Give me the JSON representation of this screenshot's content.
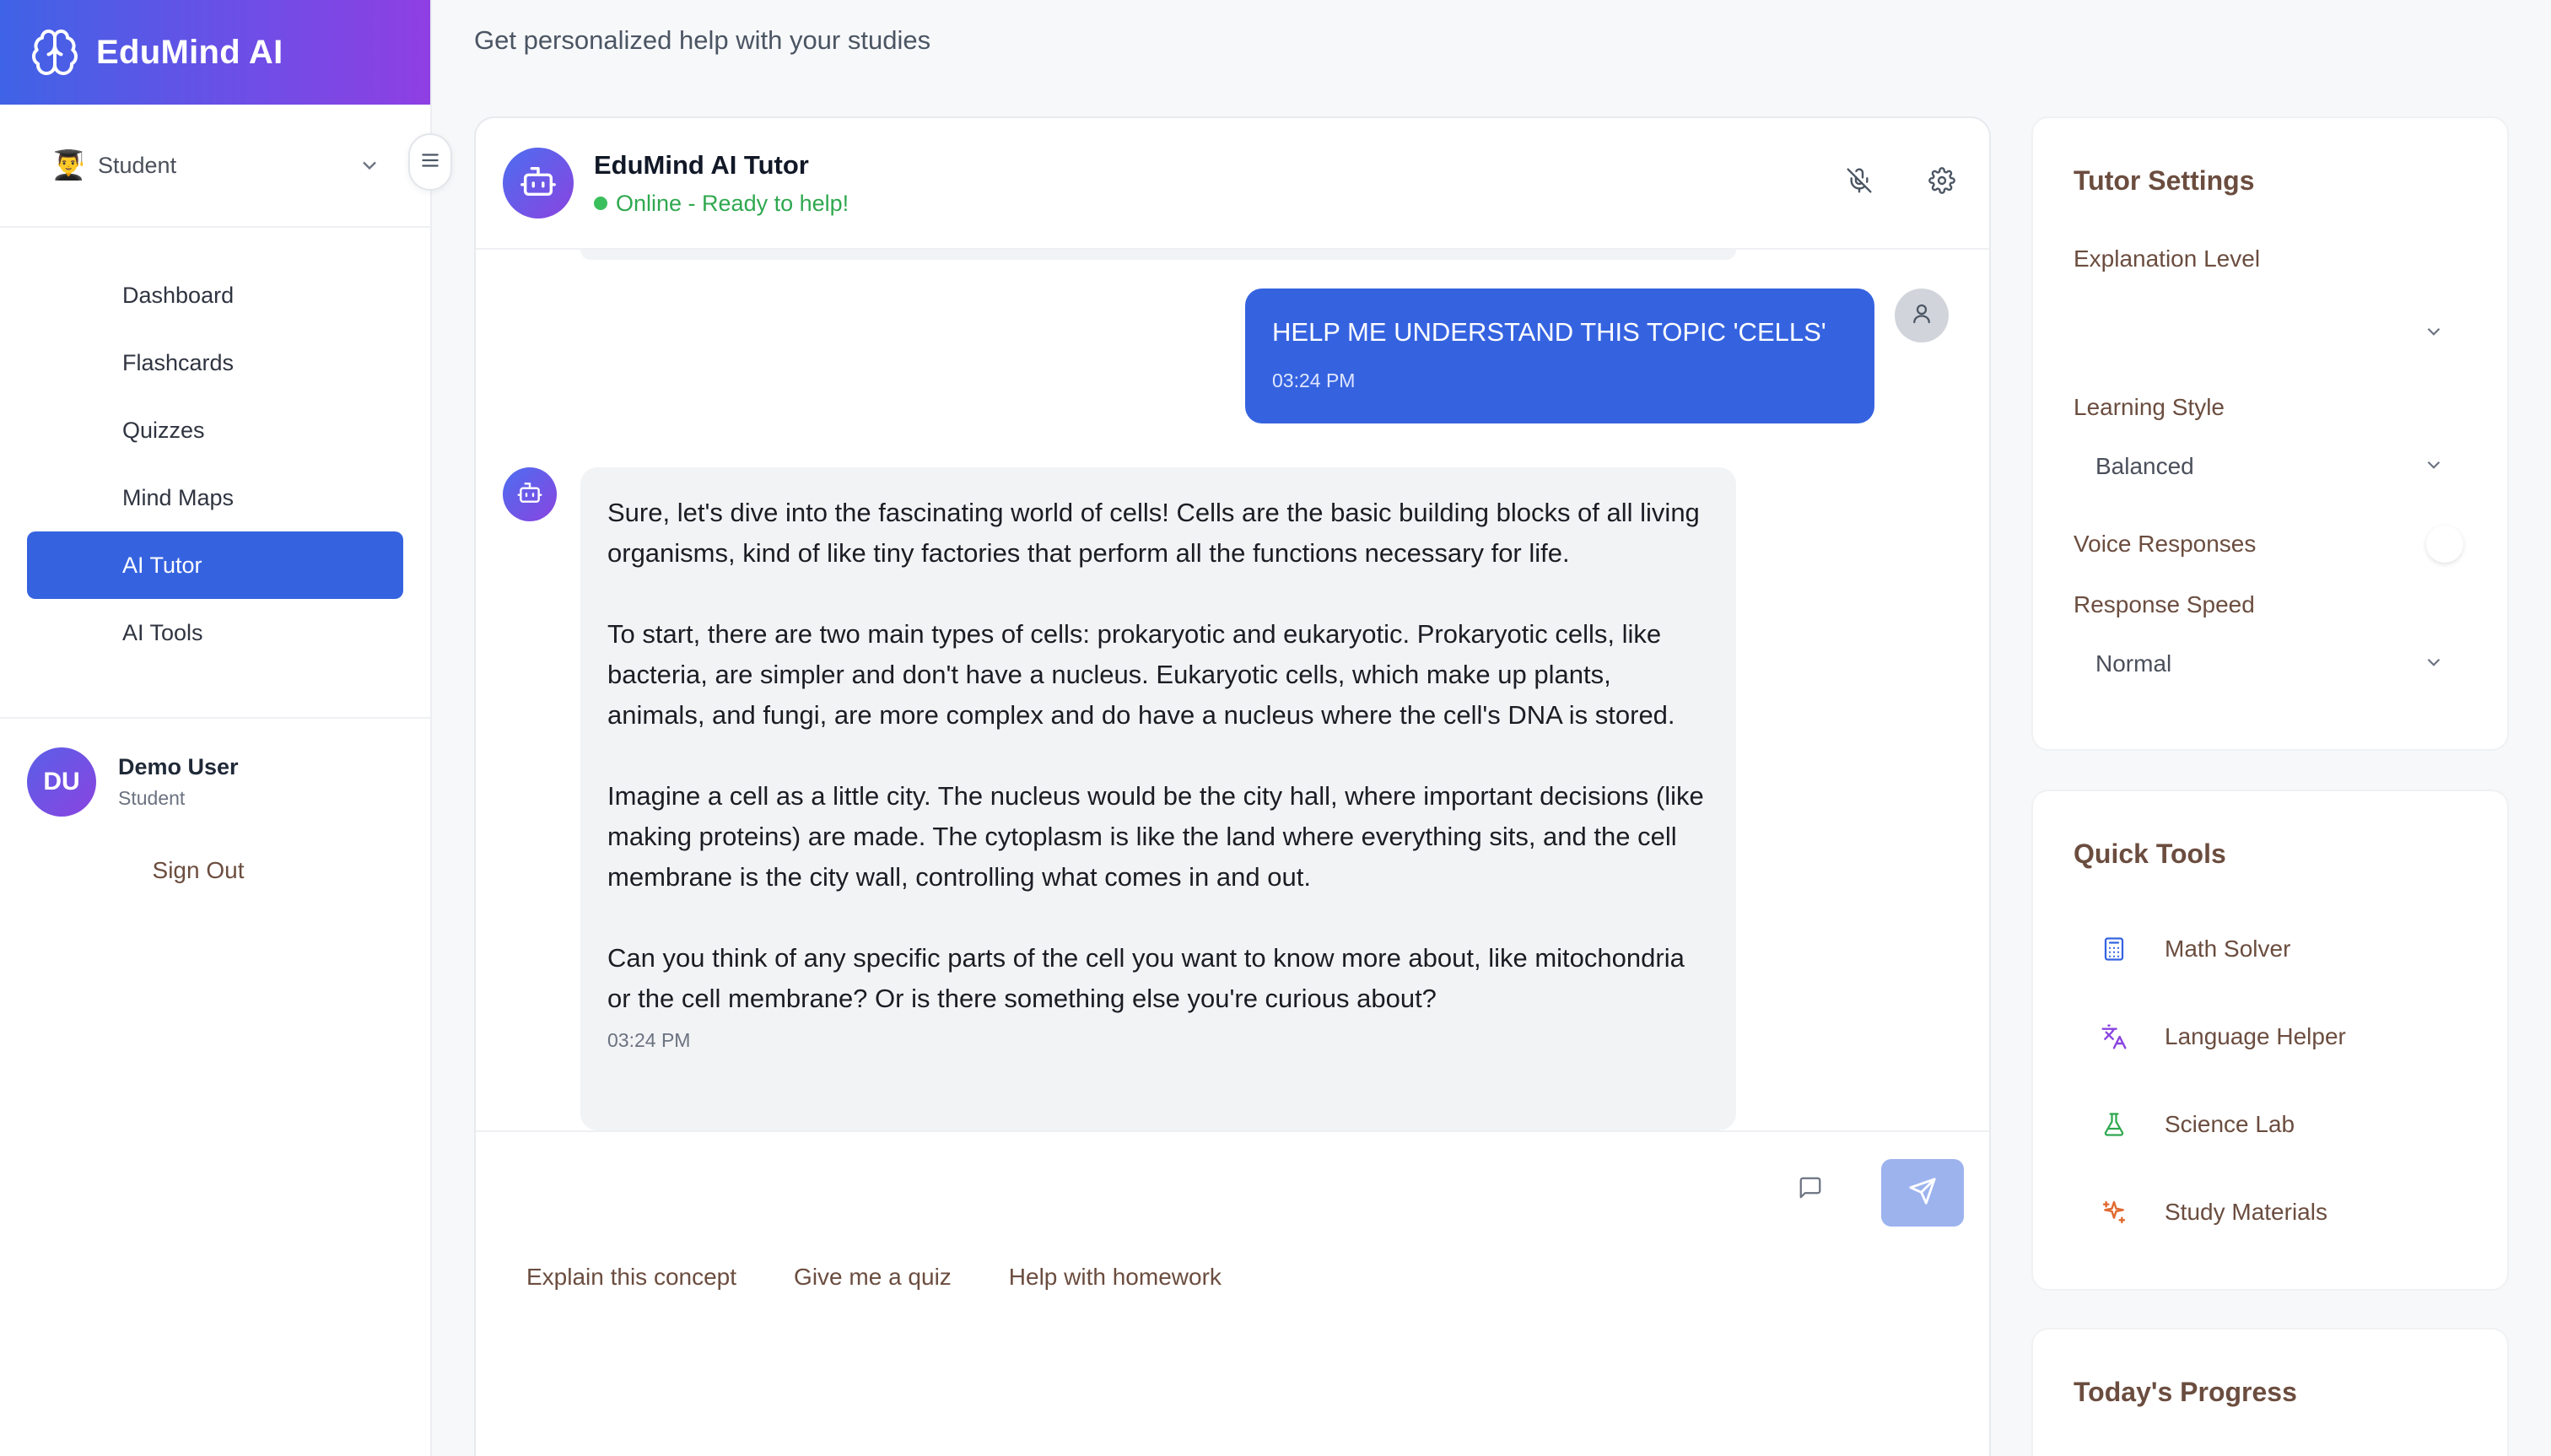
{
  "app": {
    "name": "EduMind AI",
    "subtitle": "Get personalized help with your studies"
  },
  "sidebar": {
    "role": {
      "emoji": "👨‍🎓",
      "label": "Student"
    },
    "items": [
      {
        "label": "Dashboard",
        "active": false
      },
      {
        "label": "Flashcards",
        "active": false
      },
      {
        "label": "Quizzes",
        "active": false
      },
      {
        "label": "Mind Maps",
        "active": false
      },
      {
        "label": "AI Tutor",
        "active": true
      },
      {
        "label": "AI Tools",
        "active": false
      }
    ],
    "user": {
      "initials": "DU",
      "name": "Demo User",
      "role": "Student"
    },
    "sign_out": "Sign Out"
  },
  "chat": {
    "title": "EduMind AI Tutor",
    "status": "Online - Ready to help!",
    "messages": [
      {
        "from": "user",
        "text": "HELP ME UNDERSTAND THIS TOPIC 'CELLS'",
        "time": "03:24 PM"
      },
      {
        "from": "bot",
        "paragraphs": [
          "Sure, let's dive into the fascinating world of cells! Cells are the basic building blocks of all living organisms, kind of like tiny factories that perform all the functions necessary for life.",
          "To start, there are two main types of cells: prokaryotic and eukaryotic. Prokaryotic cells, like bacteria, are simpler and don't have a nucleus. Eukaryotic cells, which make up plants, animals, and fungi, are more complex and do have a nucleus where the cell's DNA is stored.",
          "Imagine a cell as a little city. The nucleus would be the city hall, where important decisions (like making proteins) are made. The cytoplasm is like the land where everything sits, and the cell membrane is the city wall, controlling what comes in and out.",
          "Can you think of any specific parts of the cell you want to know more about, like mitochondria or the cell membrane? Or is there something else you're curious about?"
        ],
        "time": "03:24 PM"
      }
    ],
    "suggestions": [
      "Explain this concept",
      "Give me a quiz",
      "Help with homework"
    ]
  },
  "tutor_settings": {
    "title": "Tutor Settings",
    "explanation_level": {
      "label": "Explanation Level",
      "value": ""
    },
    "learning_style": {
      "label": "Learning Style",
      "value": "Balanced"
    },
    "voice_responses": {
      "label": "Voice Responses",
      "enabled": false
    },
    "response_speed": {
      "label": "Response Speed",
      "value": "Normal"
    }
  },
  "quick_tools": {
    "title": "Quick Tools",
    "items": [
      {
        "label": "Math Solver",
        "icon": "calculator-icon",
        "color": "#3563e0"
      },
      {
        "label": "Language Helper",
        "icon": "translate-icon",
        "color": "#8a44e0"
      },
      {
        "label": "Science Lab",
        "icon": "flask-icon",
        "color": "#2fa84f"
      },
      {
        "label": "Study Materials",
        "icon": "sparkles-icon",
        "color": "#e06a2f"
      }
    ]
  },
  "progress": {
    "title": "Today's Progress"
  },
  "colors": {
    "brand_gradient_start": "#3f63e6",
    "brand_gradient_end": "#8f3fe3",
    "primary": "#3563e0",
    "online": "#3bbf5c",
    "muted_text": "#6b4d3f"
  }
}
